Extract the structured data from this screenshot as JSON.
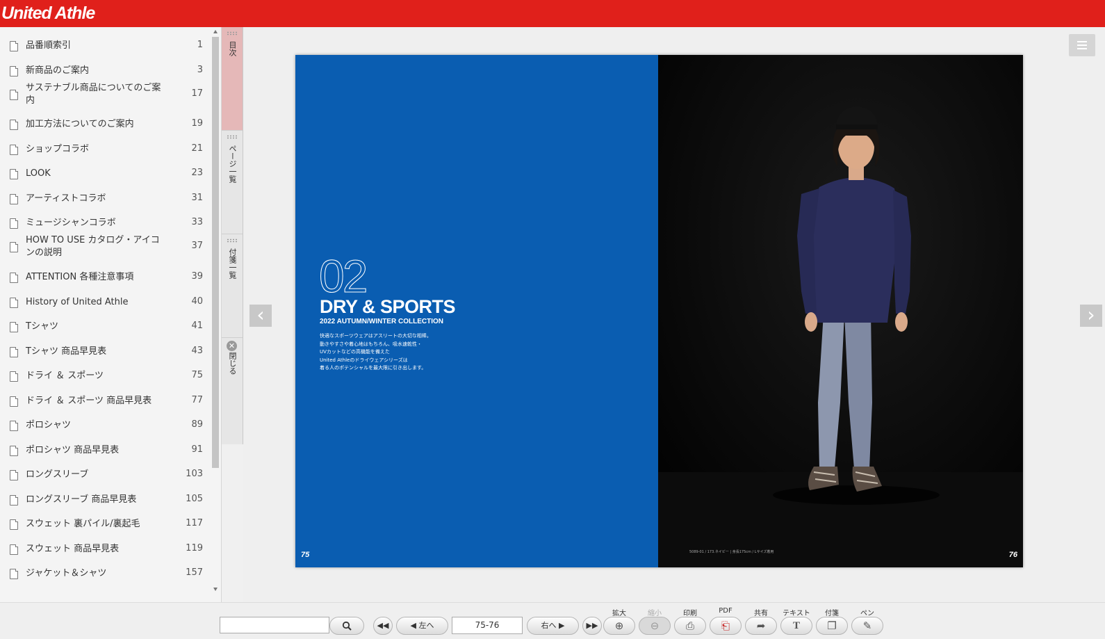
{
  "app": {
    "brand": "United Athle"
  },
  "toc": {
    "items": [
      {
        "label": "品番順索引",
        "page": "1"
      },
      {
        "label": "新商品のご案内",
        "page": "3"
      },
      {
        "label": "サステナブル商品についてのご案内",
        "page": "17"
      },
      {
        "label": "加工方法についてのご案内",
        "page": "19"
      },
      {
        "label": "ショップコラボ",
        "page": "21"
      },
      {
        "label": "LOOK",
        "page": "23"
      },
      {
        "label": "アーティストコラボ",
        "page": "31"
      },
      {
        "label": "ミュージシャンコラボ",
        "page": "33"
      },
      {
        "label": "HOW TO USE カタログ・アイコンの説明",
        "page": "37"
      },
      {
        "label": "ATTENTION 各種注意事項",
        "page": "39"
      },
      {
        "label": "History of United Athle",
        "page": "40"
      },
      {
        "label": "Tシャツ",
        "page": "41"
      },
      {
        "label": "Tシャツ 商品早見表",
        "page": "43"
      },
      {
        "label": "ドライ ＆ スポーツ",
        "page": "75"
      },
      {
        "label": "ドライ ＆ スポーツ 商品早見表",
        "page": "77"
      },
      {
        "label": "ポロシャツ",
        "page": "89"
      },
      {
        "label": "ポロシャツ 商品早見表",
        "page": "91"
      },
      {
        "label": "ロングスリーブ",
        "page": "103"
      },
      {
        "label": "ロングスリーブ 商品早見表",
        "page": "105"
      },
      {
        "label": "スウェット 裏パイル/裏起毛",
        "page": "117"
      },
      {
        "label": "スウェット 商品早見表",
        "page": "119"
      },
      {
        "label": "ジャケット＆シャツ",
        "page": "157"
      }
    ]
  },
  "side_tabs": {
    "toc": "目次",
    "pages": "ページ一覧",
    "notes": "付箋一覧",
    "close": "閉じる"
  },
  "spread": {
    "section_number": "02",
    "section_title": "DRY & SPORTS",
    "section_subtitle": "2022 AUTUMN/WINTER COLLECTION",
    "body_lines": [
      "快適なスポーツウェアはアスリートの大切な相棒。",
      "動きやすさや着心地はもちろん、吸水速乾性・",
      "UVカットなどの高機能を備えた",
      "United Athleのドライウェアシリーズは",
      "着る人のポテンシャルを最大限に引き出します。"
    ],
    "left_page_number": "75",
    "right_page_number": "76",
    "model_caption": "5089-01 / 173.ネイビー | 身長175cm / Lサイズ着用",
    "colors": {
      "left_page": "#0a5db1",
      "right_page": "#060606",
      "shirt": "#2b2e5c",
      "pants": "#8d97ae"
    }
  },
  "toolbar": {
    "search_placeholder": "",
    "prev_label": "左へ",
    "next_label": "右へ",
    "page_value": "75-76",
    "zoom_in_label": "拡大",
    "zoom_out_label": "縮小",
    "print_label": "印刷",
    "pdf_label": "PDF",
    "share_label": "共有",
    "text_label": "テキスト",
    "note_label": "付箋",
    "pen_label": "ペン"
  }
}
